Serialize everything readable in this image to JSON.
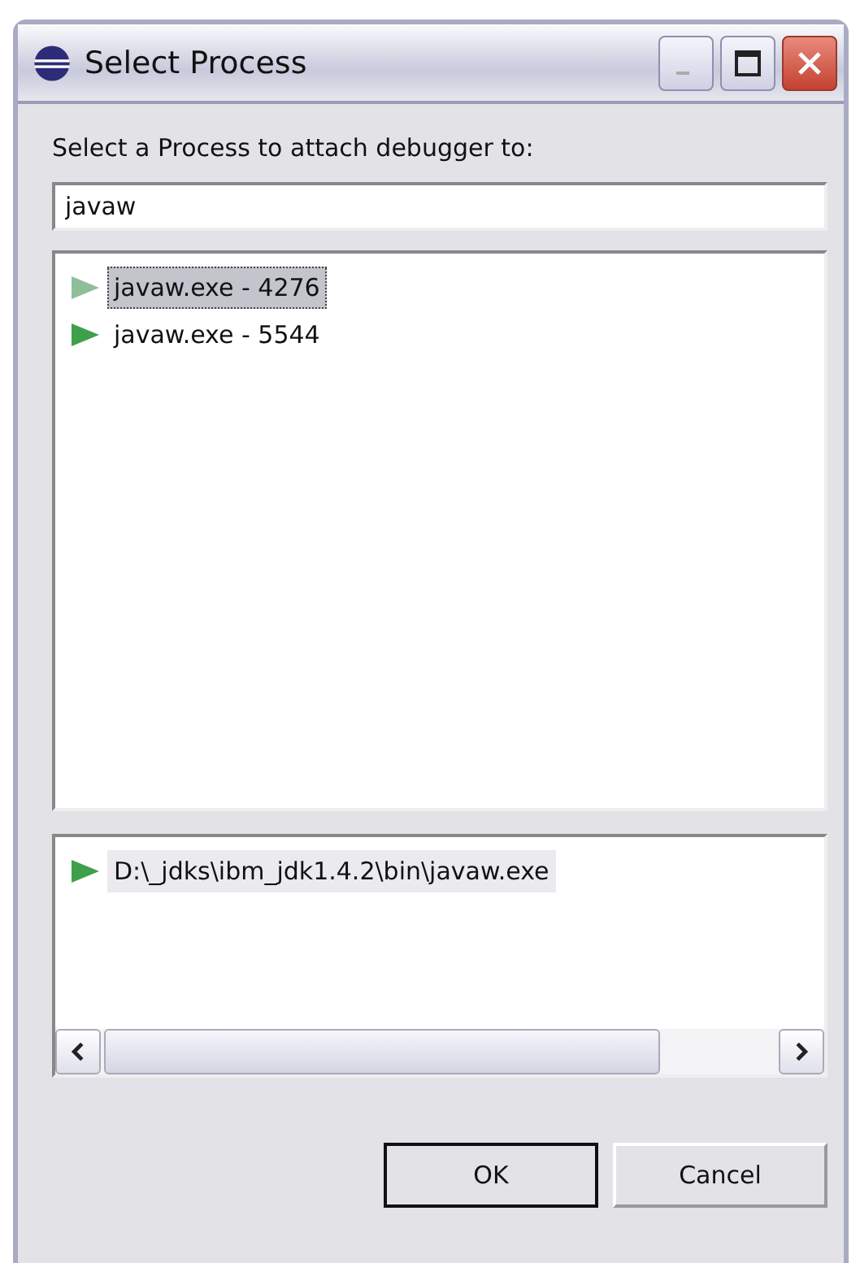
{
  "window": {
    "title": "Select Process"
  },
  "prompt": "Select a Process to attach debugger to:",
  "filter": {
    "value": "javaw"
  },
  "processes": [
    {
      "label": "javaw.exe - 4276",
      "selected": true
    },
    {
      "label": "javaw.exe - 5544",
      "selected": false
    }
  ],
  "details": [
    {
      "label": "D:\\_jdks\\ibm_jdk1.4.2\\bin\\javaw.exe",
      "selected": true
    }
  ],
  "buttons": [
    {
      "label": "OK",
      "default": true
    },
    {
      "label": "Cancel",
      "default": false
    }
  ]
}
